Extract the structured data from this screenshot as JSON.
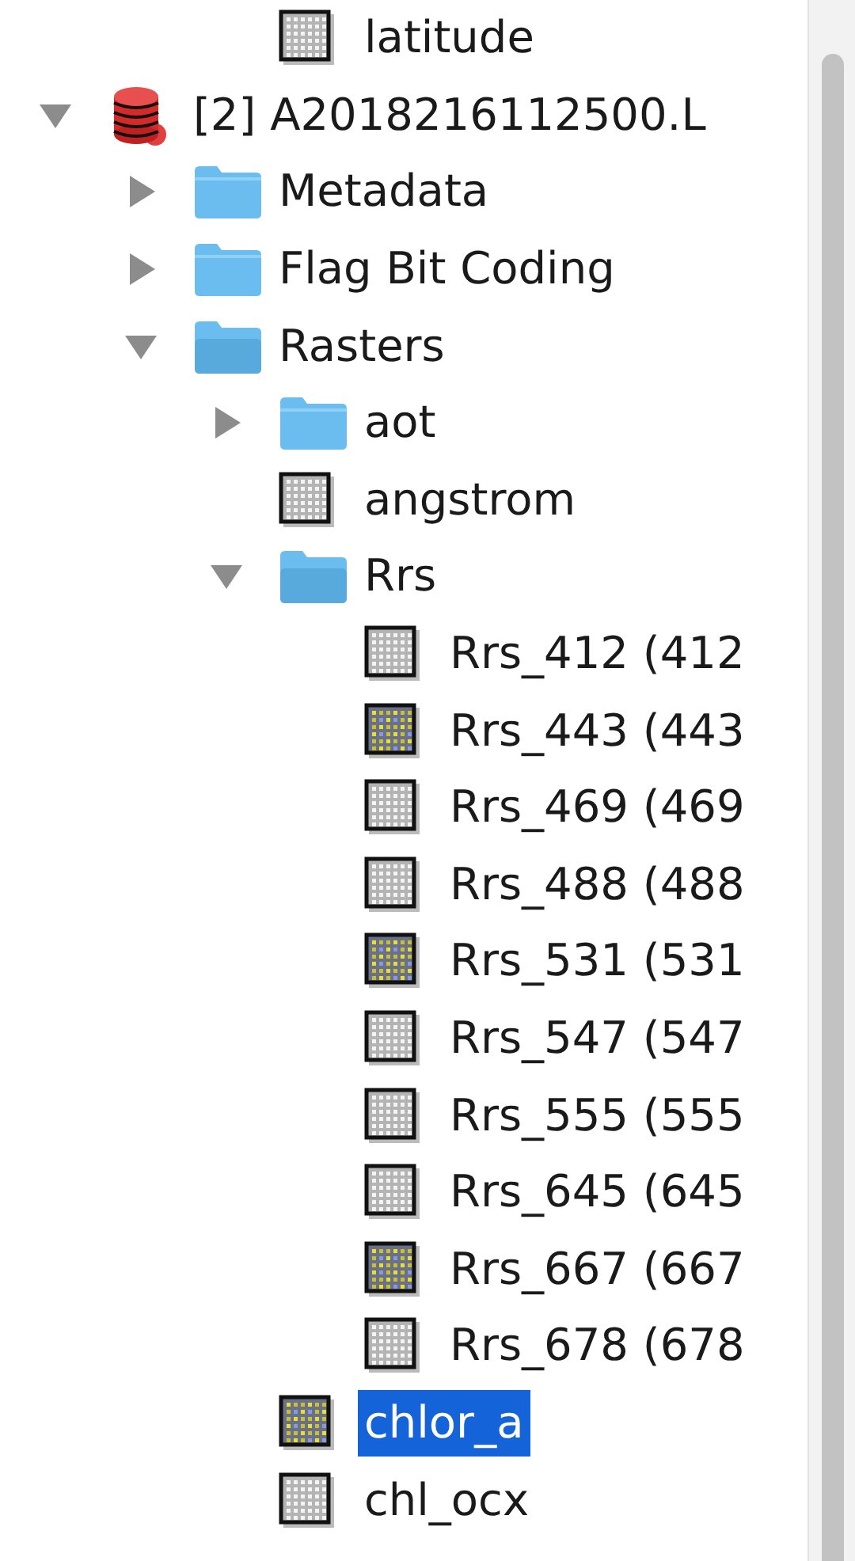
{
  "tree": {
    "scrolled_rows": [
      {
        "kind": "band",
        "label": "latitude",
        "opened": false,
        "selected": false
      }
    ],
    "items": [
      {
        "kind": "product",
        "label": "[2] A2018216112500.L",
        "expanded": true,
        "selected": false,
        "children": [
          {
            "kind": "folder",
            "label": "Metadata",
            "expanded": false,
            "selected": false
          },
          {
            "kind": "folder",
            "label": "Flag Bit Coding",
            "expanded": false,
            "selected": false
          },
          {
            "kind": "folder",
            "label": "Rasters",
            "expanded": true,
            "selected": false,
            "children": [
              {
                "kind": "folder",
                "label": "aot",
                "expanded": false,
                "selected": false
              },
              {
                "kind": "band",
                "label": "angstrom",
                "opened": false,
                "selected": false
              },
              {
                "kind": "folder",
                "label": "Rrs",
                "expanded": true,
                "selected": false,
                "children": [
                  {
                    "kind": "band",
                    "label": "Rrs_412 (412",
                    "opened": false,
                    "selected": false
                  },
                  {
                    "kind": "band",
                    "label": "Rrs_443 (443",
                    "opened": true,
                    "selected": false
                  },
                  {
                    "kind": "band",
                    "label": "Rrs_469 (469",
                    "opened": false,
                    "selected": false
                  },
                  {
                    "kind": "band",
                    "label": "Rrs_488 (488",
                    "opened": false,
                    "selected": false
                  },
                  {
                    "kind": "band",
                    "label": "Rrs_531 (531",
                    "opened": true,
                    "selected": false
                  },
                  {
                    "kind": "band",
                    "label": "Rrs_547 (547",
                    "opened": false,
                    "selected": false
                  },
                  {
                    "kind": "band",
                    "label": "Rrs_555 (555",
                    "opened": false,
                    "selected": false
                  },
                  {
                    "kind": "band",
                    "label": "Rrs_645 (645",
                    "opened": false,
                    "selected": false
                  },
                  {
                    "kind": "band",
                    "label": "Rrs_667 (667",
                    "opened": true,
                    "selected": false
                  },
                  {
                    "kind": "band",
                    "label": "Rrs_678 (678",
                    "opened": false,
                    "selected": false
                  }
                ]
              },
              {
                "kind": "band",
                "label": "chlor_a",
                "opened": true,
                "selected": true
              },
              {
                "kind": "band",
                "label": "chl_ocx",
                "opened": false,
                "selected": false
              }
            ]
          }
        ]
      }
    ]
  }
}
